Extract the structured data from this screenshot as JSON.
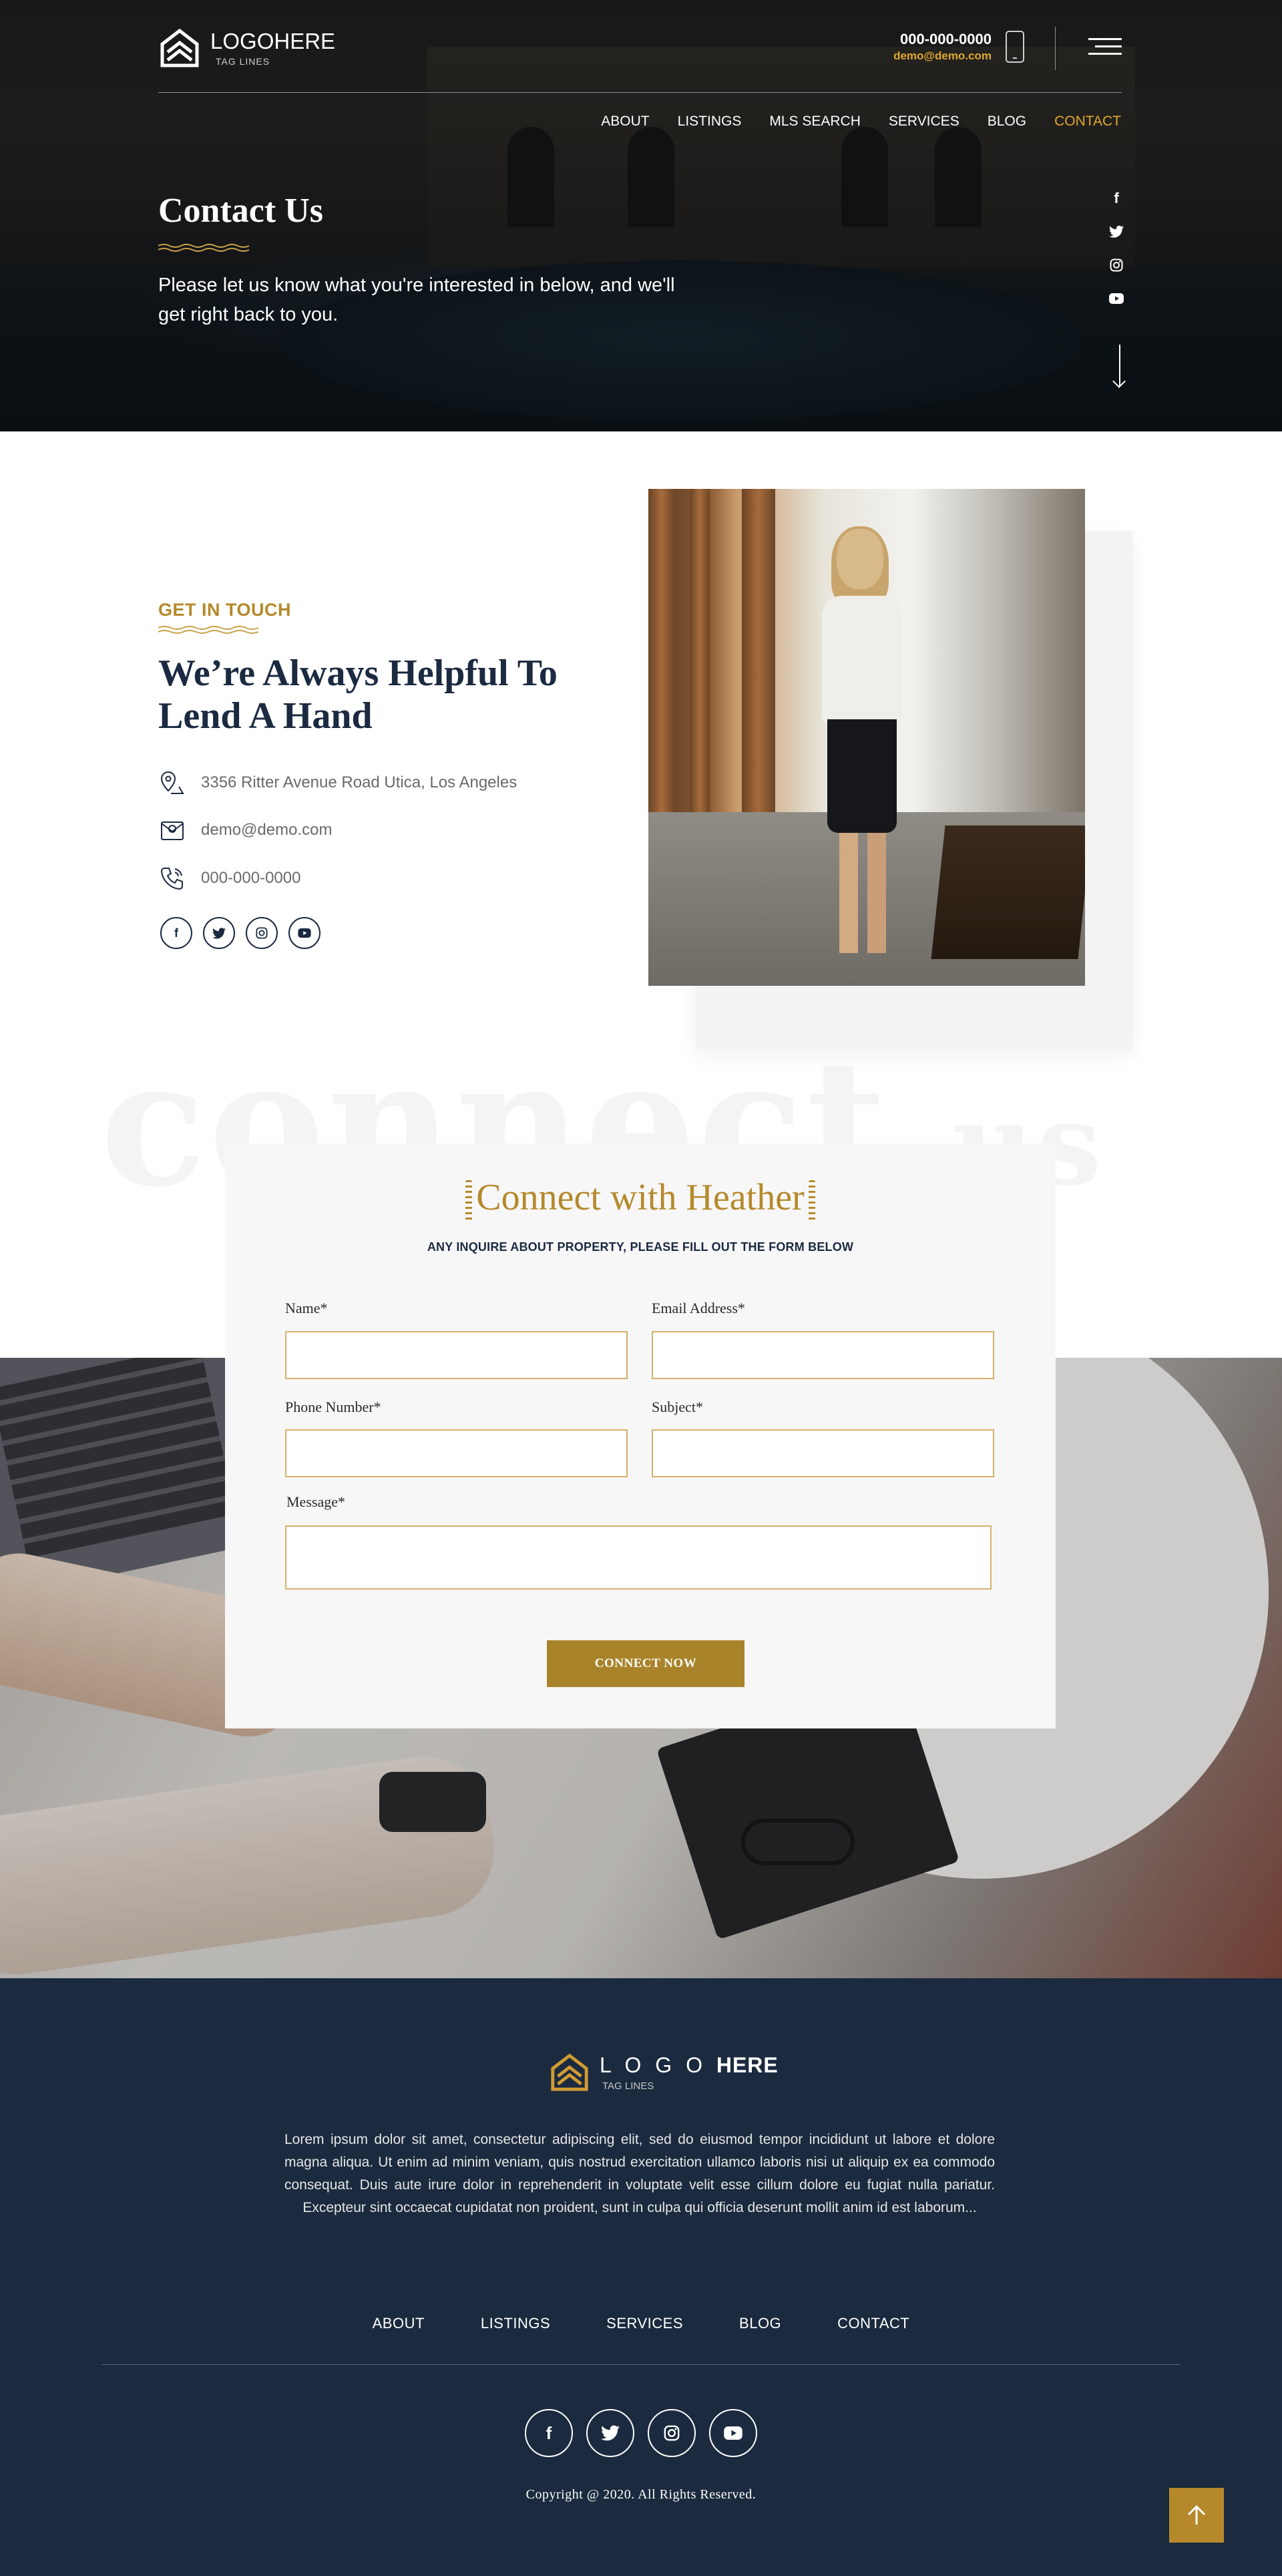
{
  "header": {
    "logo_text": "LOGOHERE",
    "logo_tagline": "TAG LINES",
    "phone": "000-000-0000",
    "email": "demo@demo.com",
    "nav": [
      "ABOUT",
      "LISTINGS",
      "MLS SEARCH",
      "SERVICES",
      "BLOG",
      "CONTACT"
    ],
    "active_nav": "CONTACT"
  },
  "hero": {
    "title": "Contact Us",
    "subtitle": "Please let us know what you're interested in below, and we'll get right back to you.",
    "social_icons": [
      "facebook-icon",
      "twitter-icon",
      "instagram-icon",
      "youtube-icon"
    ]
  },
  "contact": {
    "kicker": "GET IN TOUCH",
    "heading": "We’re Always Helpful To Lend A Hand",
    "address": "3356 Ritter Avenue Road Utica, Los Angeles",
    "email": "demo@demo.com",
    "phone": "000-000-0000",
    "social_icons": [
      "facebook-icon",
      "twitter-icon",
      "instagram-icon",
      "youtube-icon"
    ]
  },
  "watermark": {
    "main": "connect",
    "small": "us"
  },
  "form": {
    "title": "Connect with Heather",
    "subtitle": "ANY INQUIRE ABOUT  PROPERTY, PLEASE FILL OUT THE FORM BELOW",
    "name_label": "Name*",
    "email_label": "Email Address*",
    "phone_label": "Phone Number*",
    "subject_label": "Subject*",
    "message_label": "Message*",
    "name_value": "",
    "email_value": "",
    "phone_value": "",
    "subject_value": "",
    "message_value": "",
    "submit_label": "CONNECT NOW"
  },
  "footer": {
    "logo_text_a": "L O G O",
    "logo_text_b": "HERE",
    "logo_tagline": "TAG LINES",
    "paragraph": "Lorem ipsum dolor sit amet, consectetur adipiscing elit, sed do eiusmod tempor incididunt ut labore et dolore magna aliqua. Ut enim ad minim veniam, quis nostrud exercitation ullamco laboris nisi ut aliquip ex ea commodo consequat. Duis aute irure dolor in reprehenderit in voluptate velit esse cillum dolore eu fugiat nulla pariatur. Excepteur sint occaecat cupidatat non proident, sunt in culpa qui officia deserunt mollit anim id est laborum...",
    "nav": [
      "ABOUT",
      "LISTINGS",
      "SERVICES",
      "BLOG",
      "CONTACT"
    ],
    "social_icons": [
      "facebook-icon",
      "twitter-icon",
      "instagram-icon",
      "youtube-icon"
    ],
    "copyright": "Copyright @ 2020. All Rights Reserved."
  },
  "colors": {
    "accent": "#b5892b",
    "accent_bright": "#e0a82e",
    "navy": "#1b2a3e"
  }
}
